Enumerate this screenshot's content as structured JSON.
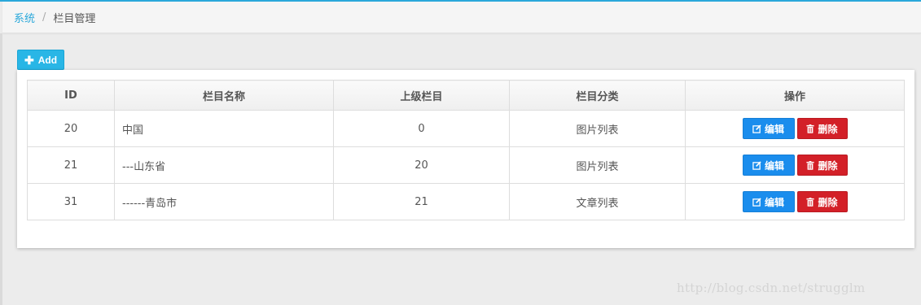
{
  "breadcrumb": {
    "items": [
      "系统",
      "栏目管理"
    ],
    "separator": "/"
  },
  "toolbar": {
    "add_label": "Add",
    "add_icon": "plus-icon"
  },
  "table": {
    "headers": [
      "ID",
      "栏目名称",
      "上级栏目",
      "栏目分类",
      "操作"
    ],
    "rows": [
      {
        "id": "20",
        "name": "中国",
        "parent": "0",
        "category": "图片列表"
      },
      {
        "id": "21",
        "name": "---山东省",
        "parent": "20",
        "category": "图片列表"
      },
      {
        "id": "31",
        "name": "------青岛市",
        "parent": "21",
        "category": "文章列表"
      }
    ],
    "actions": {
      "edit_label": "编辑",
      "edit_icon": "edit-icon",
      "delete_label": "删除",
      "delete_icon": "trash-icon"
    }
  },
  "colors": {
    "accent": "#2aa8da",
    "add_button": "#29b6e6",
    "edit_button": "#1a8ded",
    "delete_button": "#d32028"
  },
  "watermark": "http://blog.csdn.net/strugglm"
}
